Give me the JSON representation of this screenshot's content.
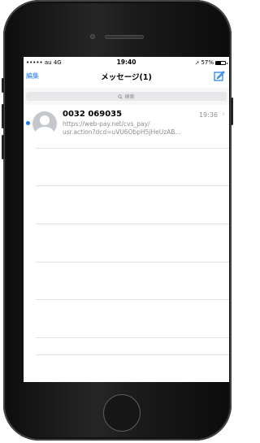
{
  "status_bar": {
    "carrier": "••••• au 4G",
    "time": "19:40",
    "battery_text": "57%",
    "battery_level": 0.57
  },
  "nav": {
    "edit_label": "編集",
    "title": "メッセージ(1)"
  },
  "search": {
    "placeholder": "検索"
  },
  "messages": [
    {
      "sender": "0032 069035",
      "time": "19:36",
      "preview_line1": "https://web-pay.net/cvs_pay/",
      "preview_line2": "usr.action?dcd=uVU6ObpH5jHeUzAB...",
      "unread": true
    }
  ],
  "colors": {
    "accent": "#1e7cf0",
    "secondary_text": "#8e8e93"
  }
}
